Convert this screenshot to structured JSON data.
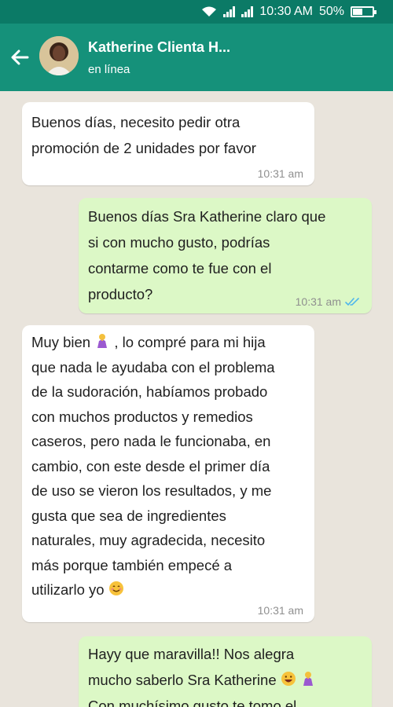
{
  "status_bar": {
    "time": "10:30 AM",
    "battery": "50%",
    "battery_level": 0.5
  },
  "header": {
    "contact_name": "Katherine Clienta H...",
    "contact_status": "en línea"
  },
  "messages": [
    {
      "direction": "incoming",
      "lines": [
        "Buenos días, necesito pedir otra",
        "promoción de 2 unidades por favor"
      ],
      "time": "10:31 am"
    },
    {
      "direction": "outgoing",
      "lines": [
        "Buenos días Sra Katherine claro que",
        "si con mucho gusto, podrías",
        "contarme como te fue con el",
        "producto?"
      ],
      "time": "10:31 am",
      "read_receipt": "double-check-icon"
    },
    {
      "direction": "incoming",
      "lines": [
        "Muy bien",
        ", lo compré para mi hija",
        "que nada le ayudaba con el problema",
        "de la sudoración, habíamos probado",
        "con muchos productos y remedios",
        "caseros, pero nada le funcionaba, en",
        "cambio, con este desde el primer día",
        "de uso se vieron los resultados, y me",
        "gusta que sea de ingredientes",
        "naturales, muy agradecida, necesito",
        "más porque también empecé a",
        "utilizarlo yo"
      ],
      "time": "10:31 am"
    },
    {
      "direction": "outgoing",
      "lines": [
        "Hayy que maravilla!! Nos alegra",
        "mucho saberlo Sra Katherine",
        "Con muchísimo gusto te tomo el"
      ]
    }
  ],
  "colors": {
    "status_bar": "#0b7a66",
    "header": "#15917a",
    "chat_background": "#e9e4dc",
    "incoming_bubble": "#ffffff",
    "outgoing_bubble": "#dcf8c6",
    "read_receipt": "#4fb6ec"
  }
}
